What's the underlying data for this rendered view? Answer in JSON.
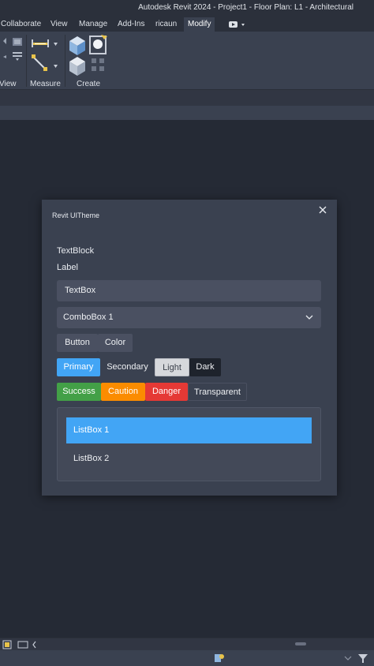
{
  "window": {
    "title": "Autodesk Revit 2024 - Project1 - Floor Plan: L1 - Architectural"
  },
  "ribbon_tabs": [
    {
      "label": "Collaborate"
    },
    {
      "label": "View"
    },
    {
      "label": "Manage"
    },
    {
      "label": "Add-Ins"
    },
    {
      "label": "ricaun"
    },
    {
      "label": "Modify",
      "active": true
    }
  ],
  "ribbon_panels": [
    {
      "label": "View"
    },
    {
      "label": "Measure"
    },
    {
      "label": "Create"
    }
  ],
  "dialog": {
    "title": "Revit UITheme",
    "textblock": "TextBlock",
    "label": "Label",
    "textbox_value": "TextBox",
    "combobox_value": "ComboBox 1",
    "buttons_row1": [
      "Button",
      "Color"
    ],
    "buttons_row2": [
      "Primary",
      "Secondary",
      "Light",
      "Dark"
    ],
    "buttons_row3": [
      "Success",
      "Caution",
      "Danger",
      "Transparent"
    ],
    "listbox_items": [
      "ListBox 1",
      "ListBox 2"
    ]
  },
  "colors": {
    "primary": "#42a5f5",
    "success": "#43a047",
    "caution": "#fb8c00",
    "danger": "#e53935",
    "background": "#252a35",
    "panel": "#3a4150"
  }
}
